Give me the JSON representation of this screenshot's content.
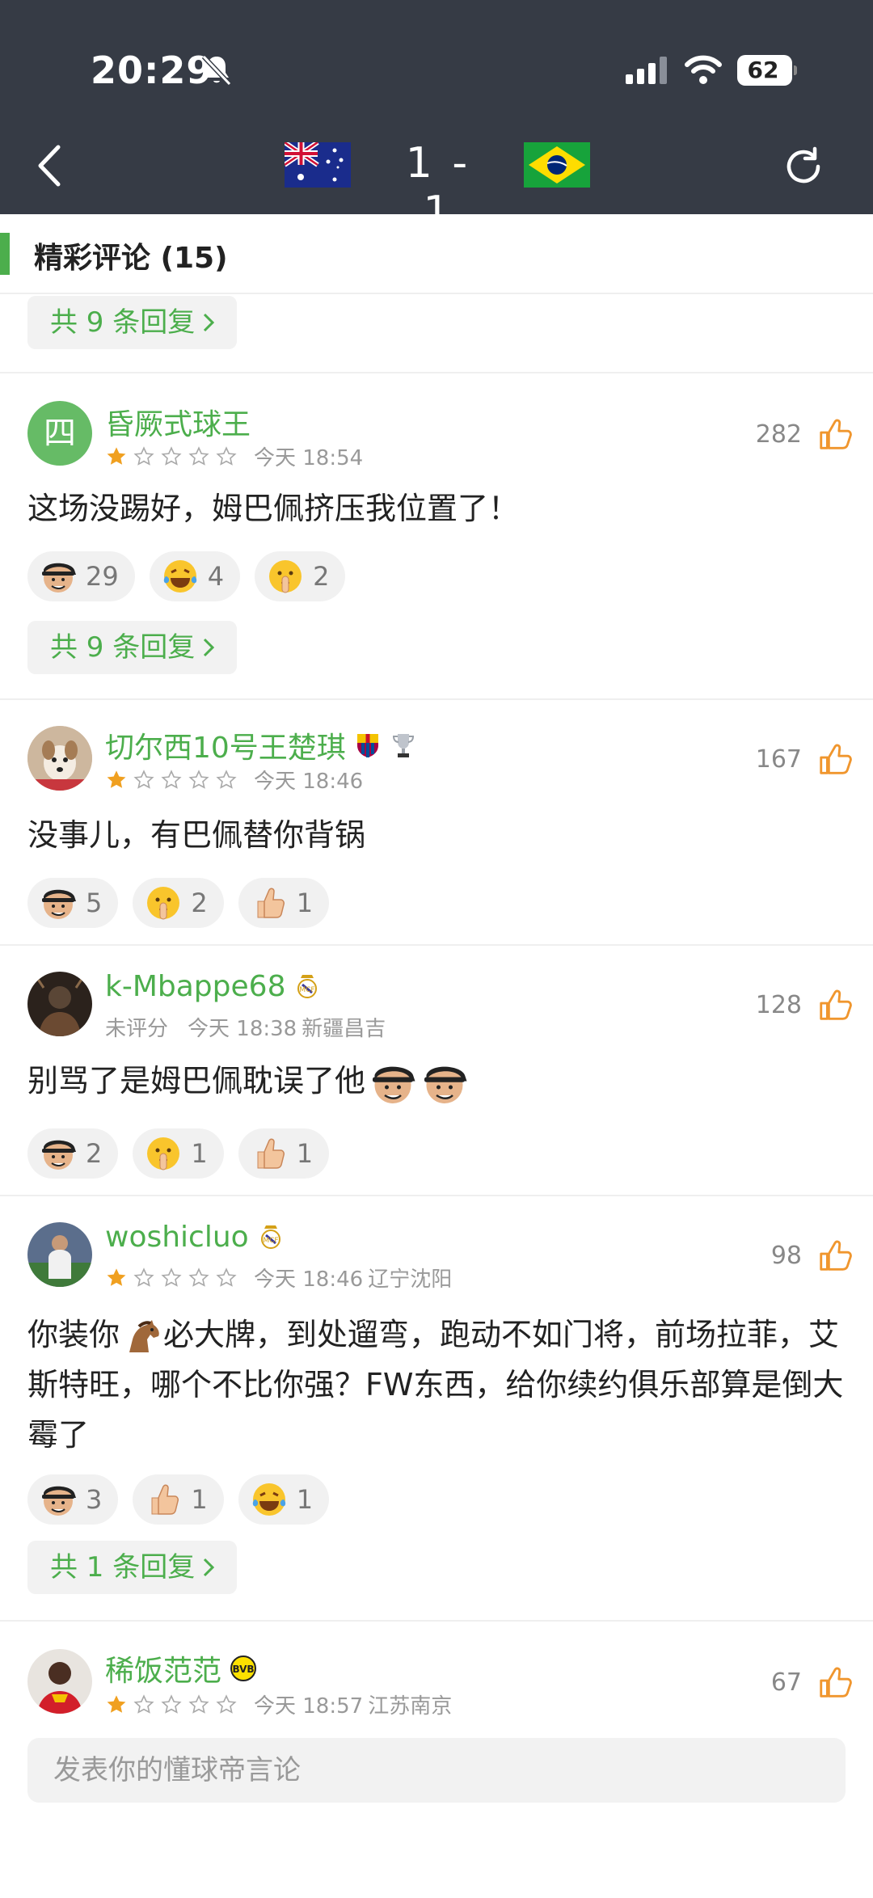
{
  "status": {
    "time": "20:29",
    "battery": "62"
  },
  "header": {
    "score": "1 - 1",
    "home_flag": "australia-flag",
    "away_flag": "brazil-flag"
  },
  "section": {
    "title": "精彩评论 (15)"
  },
  "top_reply": {
    "label": "共 9 条回复"
  },
  "comments": [
    {
      "user": "昏厥式球王",
      "avatar_letter": "四",
      "rating_stars": 1,
      "time": "今天 18:54",
      "location": "",
      "likes": "282",
      "text": "这场没踢好，姆巴佩挤压我位置了！",
      "reactions": [
        {
          "icon": "smirk-face-icon",
          "count": "29"
        },
        {
          "icon": "laugh-cry-icon",
          "count": "4"
        },
        {
          "icon": "shush-face-icon",
          "count": "2"
        }
      ],
      "replies": "共 9 条回复"
    },
    {
      "user": "切尔西10号王楚琪",
      "badges": [
        "barcelona-badge-icon",
        "trophy-icon"
      ],
      "rating_stars": 1,
      "time": "今天 18:46",
      "location": "",
      "likes": "167",
      "text": "没事儿，有巴佩替你背锅",
      "reactions": [
        {
          "icon": "smirk-face-icon",
          "count": "5"
        },
        {
          "icon": "shush-face-icon",
          "count": "2"
        },
        {
          "icon": "thumbs-up-hand-icon",
          "count": "1"
        }
      ]
    },
    {
      "user": "k-Mbappe68",
      "badges": [
        "real-madrid-badge-icon"
      ],
      "rating_text": "未评分",
      "time": "今天 18:38",
      "location": "新疆昌吉",
      "likes": "128",
      "text": "别骂了是姆巴佩耽误了他",
      "reactions": [
        {
          "icon": "smirk-face-icon",
          "count": "2"
        },
        {
          "icon": "shush-face-icon",
          "count": "1"
        },
        {
          "icon": "thumbs-up-hand-icon",
          "count": "1"
        }
      ]
    },
    {
      "user": "woshicluo",
      "badges": [
        "real-madrid-badge-icon"
      ],
      "rating_stars": 1,
      "time": "今天 18:46",
      "location": "辽宁沈阳",
      "likes": "98",
      "text_before": "你装你",
      "text": "必大牌，到处遛弯，跑动不如门将，前场拉菲，艾斯特旺，哪个不比你强？FW东西，给你续约俱乐部算是倒大霉了",
      "reactions": [
        {
          "icon": "smirk-face-icon",
          "count": "3"
        },
        {
          "icon": "thumbs-up-hand-icon",
          "count": "1"
        },
        {
          "icon": "laugh-cry-icon",
          "count": "1"
        }
      ],
      "replies": "共 1 条回复"
    },
    {
      "user": "稀饭范范",
      "badges": [
        "dortmund-badge-icon"
      ],
      "rating_stars": 1,
      "time": "今天 18:57",
      "location": "江苏南京",
      "likes": "67"
    }
  ],
  "input": {
    "placeholder": "发表你的懂球帝言论"
  },
  "colors": {
    "header_bg": "#363b45",
    "accent_green": "#4cae4c",
    "star_gold": "#f0a020",
    "thumb_orange": "#f0962e"
  }
}
